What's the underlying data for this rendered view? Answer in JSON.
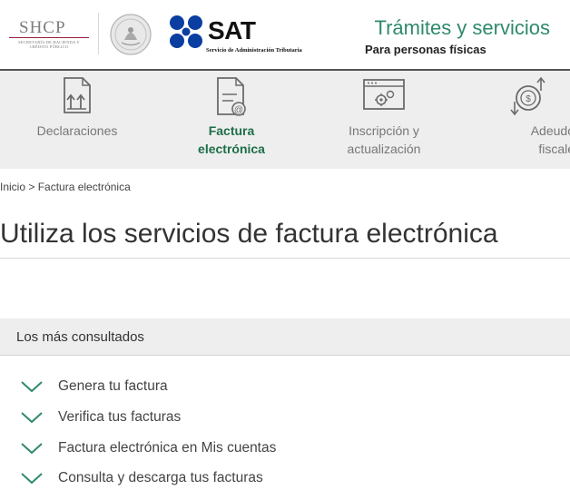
{
  "header": {
    "shcp_title": "SHCP",
    "shcp_subtitle": "SECRETARÍA DE HACIENDA Y CRÉDITO PÚBLICO",
    "sat_name": "SAT",
    "sat_subtitle": "Servicio de Administración Tributaria",
    "title": "Trámites y servicios",
    "subtitle": "Para personas físicas",
    "accent_color": "#2f8a6b",
    "sat_dot_color": "#0a3ea0"
  },
  "nav": {
    "items": [
      {
        "label_line1": "Declaraciones",
        "label_line2": "",
        "icon": "declaraciones-document-icon",
        "active": false
      },
      {
        "label_line1": "Factura",
        "label_line2": "electrónica",
        "icon": "factura-email-document-icon",
        "active": true
      },
      {
        "label_line1": "Inscripción y",
        "label_line2": "actualización",
        "icon": "inscripcion-browser-gear-icon",
        "active": false
      },
      {
        "label_line1": "Adeudos",
        "label_line2": "fiscales",
        "icon": "adeudos-coin-arrows-icon",
        "active": false
      }
    ],
    "active_color": "#1e6f49",
    "icon_color": "#6b6b6b"
  },
  "breadcrumb": {
    "home": "Inicio",
    "separator": " > ",
    "current": "Factura electrónica"
  },
  "page": {
    "title": "Utiliza los servicios de factura electrónica"
  },
  "section": {
    "header": "Los más consultados",
    "items": [
      "Genera tu factura",
      "Verifica tus facturas",
      "Factura electrónica en Mis cuentas",
      "Consulta y descarga tus facturas"
    ],
    "chevron_color": "#2f8a6b"
  }
}
